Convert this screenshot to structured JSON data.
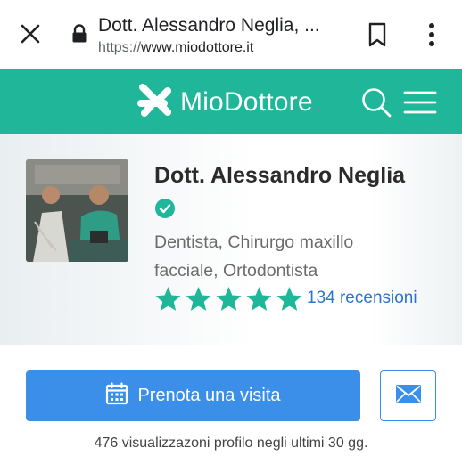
{
  "browser": {
    "page_title": "Dott. Alessandro Neglia, ...",
    "url_scheme": "https://",
    "url_host": "www.miodottore.it"
  },
  "header": {
    "brand": "MioDottore",
    "brand_color": "#1fb69a"
  },
  "profile": {
    "name": "Dott. Alessandro Neglia",
    "specialties_line1": "Dentista, Chirurgo maxillo",
    "specialties_line2": "facciale, Ortodontista",
    "rating_stars": 5,
    "reviews": "134 recensioni",
    "verified": true
  },
  "actions": {
    "book_label": "Prenota una visita",
    "views_text": "476 visualizzazoni profilo negli ultimi 30 gg."
  },
  "icons": [
    "close-icon",
    "lock-icon",
    "bookmark-icon",
    "more-vert-icon",
    "logo-icon",
    "search-icon",
    "menu-icon",
    "verified-icon",
    "star-icon",
    "calendar-icon",
    "mail-icon"
  ],
  "colors": {
    "accent": "#3b8fe8",
    "star": "#1fb69a",
    "link": "#2c73d2"
  }
}
